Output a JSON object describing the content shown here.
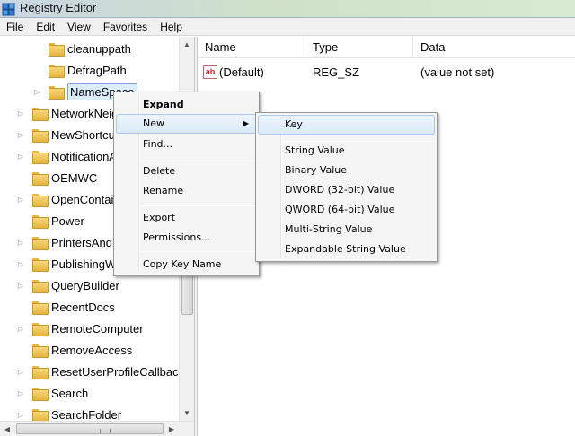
{
  "window": {
    "title": "Registry Editor"
  },
  "menubar": [
    "File",
    "Edit",
    "View",
    "Favorites",
    "Help"
  ],
  "tree": [
    {
      "label": "cleanuppath",
      "level": 2,
      "expander": false,
      "selected": false
    },
    {
      "label": "DefragPath",
      "level": 2,
      "expander": false,
      "selected": false
    },
    {
      "label": "NameSpace",
      "level": 2,
      "expander": true,
      "selected": true
    },
    {
      "label": "NetworkNeigh",
      "level": 1,
      "expander": true,
      "selected": false
    },
    {
      "label": "NewShortcut",
      "level": 1,
      "expander": true,
      "selected": false
    },
    {
      "label": "NotificationA",
      "level": 1,
      "expander": true,
      "selected": false
    },
    {
      "label": "OEMWC",
      "level": 1,
      "expander": false,
      "selected": false
    },
    {
      "label": "OpenContain",
      "level": 1,
      "expander": true,
      "selected": false
    },
    {
      "label": "Power",
      "level": 1,
      "expander": false,
      "selected": false
    },
    {
      "label": "PrintersAndF",
      "level": 1,
      "expander": true,
      "selected": false
    },
    {
      "label": "PublishingWi",
      "level": 1,
      "expander": true,
      "selected": false
    },
    {
      "label": "QueryBuilder",
      "level": 1,
      "expander": true,
      "selected": false
    },
    {
      "label": "RecentDocs",
      "level": 1,
      "expander": false,
      "selected": false
    },
    {
      "label": "RemoteComputer",
      "level": 1,
      "expander": true,
      "selected": false
    },
    {
      "label": "RemoveAccess",
      "level": 1,
      "expander": false,
      "selected": false
    },
    {
      "label": "ResetUserProfileCallbacks",
      "level": 1,
      "expander": true,
      "selected": false
    },
    {
      "label": "Search",
      "level": 1,
      "expander": true,
      "selected": false
    },
    {
      "label": "SearchFolder",
      "level": 1,
      "expander": true,
      "selected": false
    }
  ],
  "list": {
    "columns": [
      "Name",
      "Type",
      "Data"
    ],
    "rows": [
      {
        "icon": "ab",
        "name": "(Default)",
        "type": "REG_SZ",
        "data": "(value not set)"
      }
    ]
  },
  "context_menu": {
    "items": [
      {
        "label": "Expand",
        "bold": true
      },
      {
        "label": "New",
        "submenu": true,
        "highlighted": true
      },
      {
        "label": "Find..."
      },
      {
        "separator": true
      },
      {
        "label": "Delete"
      },
      {
        "label": "Rename"
      },
      {
        "separator": true
      },
      {
        "label": "Export"
      },
      {
        "label": "Permissions..."
      },
      {
        "separator": true
      },
      {
        "label": "Copy Key Name"
      }
    ]
  },
  "new_submenu": {
    "items": [
      {
        "label": "Key",
        "highlighted": true
      },
      {
        "separator": true
      },
      {
        "label": "String Value"
      },
      {
        "label": "Binary Value"
      },
      {
        "label": "DWORD (32-bit) Value"
      },
      {
        "label": "QWORD (64-bit) Value"
      },
      {
        "label": "Multi-String Value"
      },
      {
        "label": "Expandable String Value"
      }
    ]
  },
  "icons": {
    "app": "registry-icon",
    "folder": "folder-icon",
    "value": "string-value-icon",
    "expander": "expand-arrow-icon"
  }
}
